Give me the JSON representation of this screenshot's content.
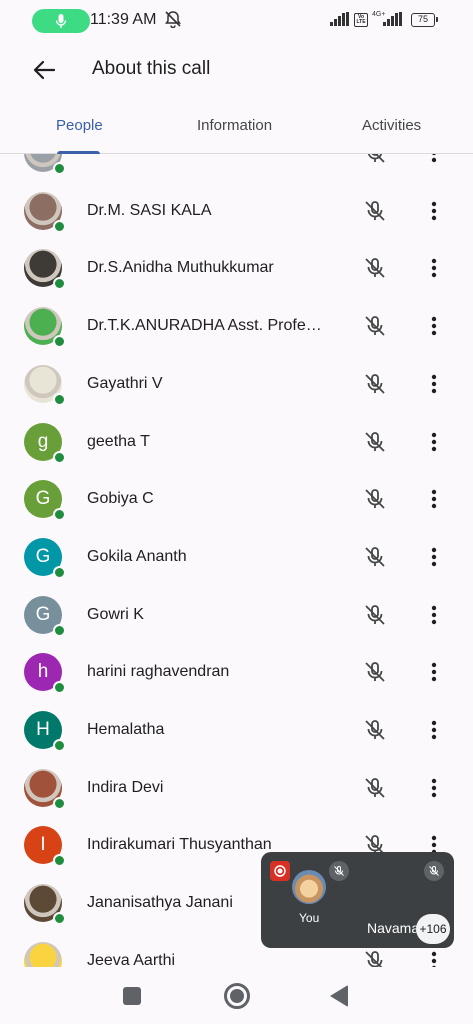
{
  "status_bar": {
    "time": "11:39 AM",
    "battery": "75",
    "network": "4G+",
    "volte": "Vo LTE",
    "icons": [
      "mic-active-icon",
      "bell-off-icon",
      "signal-icon",
      "signal-icon"
    ]
  },
  "app_bar": {
    "title": "About this call",
    "back_icon": "arrow-back-icon"
  },
  "tabs": [
    {
      "label": "People",
      "active": true
    },
    {
      "label": "Information",
      "active": false
    },
    {
      "label": "Activities",
      "active": false
    }
  ],
  "colors": {
    "accent": "#3b5fa8",
    "online": "#1e8e3e",
    "record": "#d93025"
  },
  "participants": [
    {
      "name": "",
      "initial": "",
      "avatar_color": "#9aa0a6",
      "photo": true,
      "muted": true
    },
    {
      "name": "Dr.M. SASI KALA",
      "initial": "",
      "avatar_color": "#8d6e63",
      "photo": true,
      "muted": true
    },
    {
      "name": "Dr.S.Anidha Muthukkumar",
      "initial": "",
      "avatar_color": "#3e3a36",
      "photo": true,
      "muted": true
    },
    {
      "name": "Dr.T.K.ANURADHA Asst. Profe…",
      "initial": "",
      "avatar_color": "#4caf50",
      "photo": true,
      "muted": true
    },
    {
      "name": "Gayathri V",
      "initial": "",
      "avatar_color": "#e8e4d6",
      "photo": true,
      "muted": true
    },
    {
      "name": "geetha T",
      "initial": "g",
      "avatar_color": "#689f38",
      "photo": false,
      "muted": true
    },
    {
      "name": "Gobiya C",
      "initial": "G",
      "avatar_color": "#689f38",
      "photo": false,
      "muted": true
    },
    {
      "name": "Gokila Ananth",
      "initial": "G",
      "avatar_color": "#0097a7",
      "photo": false,
      "muted": true
    },
    {
      "name": "Gowri K",
      "initial": "G",
      "avatar_color": "#78909c",
      "photo": false,
      "muted": true
    },
    {
      "name": "harini raghavendran",
      "initial": "h",
      "avatar_color": "#9c27b0",
      "photo": false,
      "muted": true
    },
    {
      "name": "Hemalatha",
      "initial": "H",
      "avatar_color": "#00796b",
      "photo": false,
      "muted": true
    },
    {
      "name": "Indira Devi",
      "initial": "",
      "avatar_color": "#a1523b",
      "photo": true,
      "muted": true
    },
    {
      "name": "Indirakumari Thusyanthan",
      "initial": "I",
      "avatar_color": "#d84315",
      "photo": false,
      "muted": true
    },
    {
      "name": "Jananisathya Janani",
      "initial": "",
      "avatar_color": "#5d4a36",
      "photo": true,
      "muted": true
    },
    {
      "name": "Jeeva Aarthi",
      "initial": "",
      "avatar_color": "#f9d340",
      "photo": true,
      "muted": true
    }
  ],
  "pip": {
    "self_label": "You",
    "other_label": "Navama",
    "more_count": "+106",
    "record_icon": "record-icon"
  },
  "nav": {
    "icons": [
      "recents-square-icon",
      "home-circle-icon",
      "back-triangle-icon"
    ]
  }
}
